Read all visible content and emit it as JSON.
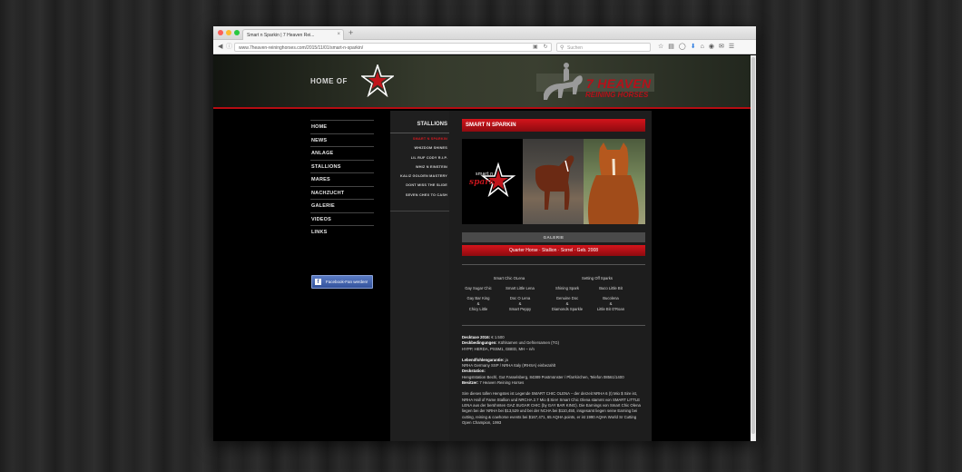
{
  "browser": {
    "tab_title": "Smart n Sparkin | 7 Heaven Rei...",
    "tab_close": "×",
    "new_tab": "+",
    "url": "www.7heaven-reininghorses.com/2015/11/01/smart-n-sparkin/",
    "search_placeholder": "Suchen"
  },
  "header": {
    "home_of": "HOME OF",
    "logo_smart": "smart n",
    "logo_sparkin": "sparkin",
    "brand_title": "7 HEAVEN",
    "brand_subtitle": "REINING HORSES",
    "accent_color": "#b50c12"
  },
  "main_nav": [
    {
      "label": "HOME"
    },
    {
      "label": "NEWS"
    },
    {
      "label": "ANLAGE"
    },
    {
      "label": "STALLIONS"
    },
    {
      "label": "MARES"
    },
    {
      "label": "NACHZUCHT"
    },
    {
      "label": "GALERIE"
    },
    {
      "label": "VIDEOS"
    },
    {
      "label": "LINKS"
    }
  ],
  "facebook": {
    "label": "Facebook-Fan werden!",
    "icon": "f"
  },
  "stallions": {
    "heading": "STALLIONS",
    "items": [
      {
        "label": "SMART N SPARKIN",
        "active": true
      },
      {
        "label": "WHIZDOM SHINES",
        "active": false
      },
      {
        "label": "LIL RUF CODY R.I.P.",
        "active": false
      },
      {
        "label": "WHIZ N EINSTEIN",
        "active": false
      },
      {
        "label": "KALIZ GOLDEN MASTERY",
        "active": false
      },
      {
        "label": "DONT MISS THE SLIDE",
        "active": false
      },
      {
        "label": "SEVEN CHEX TO CASH",
        "active": false
      }
    ]
  },
  "content": {
    "title": "SMART N SPARKIN",
    "gallery_label": "GALERIE",
    "info": "Quarter Horse · Stallion · Sorrel · Geb. 2008",
    "pedigree": {
      "sire": "Smart Chic OLena",
      "dam": "Setting Off Sparks",
      "gs1": "Gay Sugar Chic",
      "gs2": "Smart Little Lena",
      "gs3": "Shining Spark",
      "gs4": "Buco Little Bit",
      "g1a": "Gay Bar King",
      "g1b": "Chicy Little",
      "g2a": "Doc O Lena",
      "g2b": "Smart Peppy",
      "g3a": "Genuine Doc",
      "g3b": "Diamonds Sparkle",
      "g4a": "Bucolena",
      "g4b": "Little Bit O'Roan",
      "amp": "&"
    },
    "details": {
      "decktaxe_label": "Decktaxe 2016:",
      "decktaxe_value": "€ 1.500",
      "deckbed_label": "Deckbedingungen:",
      "deckbed_value": "Kühlsamen und Gefriersamen (TG)",
      "genetics": "HYPP, HERDA, PSSM1, GBED, MH – n/n",
      "lebend_label": "Lebendfohlengarantie:",
      "lebend_value": "ja",
      "nrha": "NRHA Germany SSP / NRHA Italy (IRHSA) einbezahlt",
      "deckstation_label": "Deckstation:",
      "deckstation_value": "Hengststation Bechl, Gut Fasselsberg, 84389 Postmünster / Pfarrkirchen, Telefon 08561/1400",
      "besitzer_label": "Besitzer:",
      "besitzer_value": "7 Heaven Reining Horses",
      "text": "Sire dieses tollen Hengstes ist Legende SMART CHIC OLENA – der derzeit NRHA 6 (t) Mio $ Sire ist, NRHA Hall of Fame Stallion und NRCHA 2.7 Mio $ Sire! Smart Chic Olena stammt von SMART LITTLE LENA aus der berühmten GAZ SUGAR CHIC (by GAY BAR KING). Die Earnings von Smart Chic Olena liegen bei der NRHA bei $13,529 und bei der NCHA bei $110,450, insgesamt liegen seine Earning bei cutting, reining & cowhorse events bei $167,471, 65 AQHA points, er ist 1990 AQHA World Sr Cutting Open Champion, 1993"
    }
  }
}
